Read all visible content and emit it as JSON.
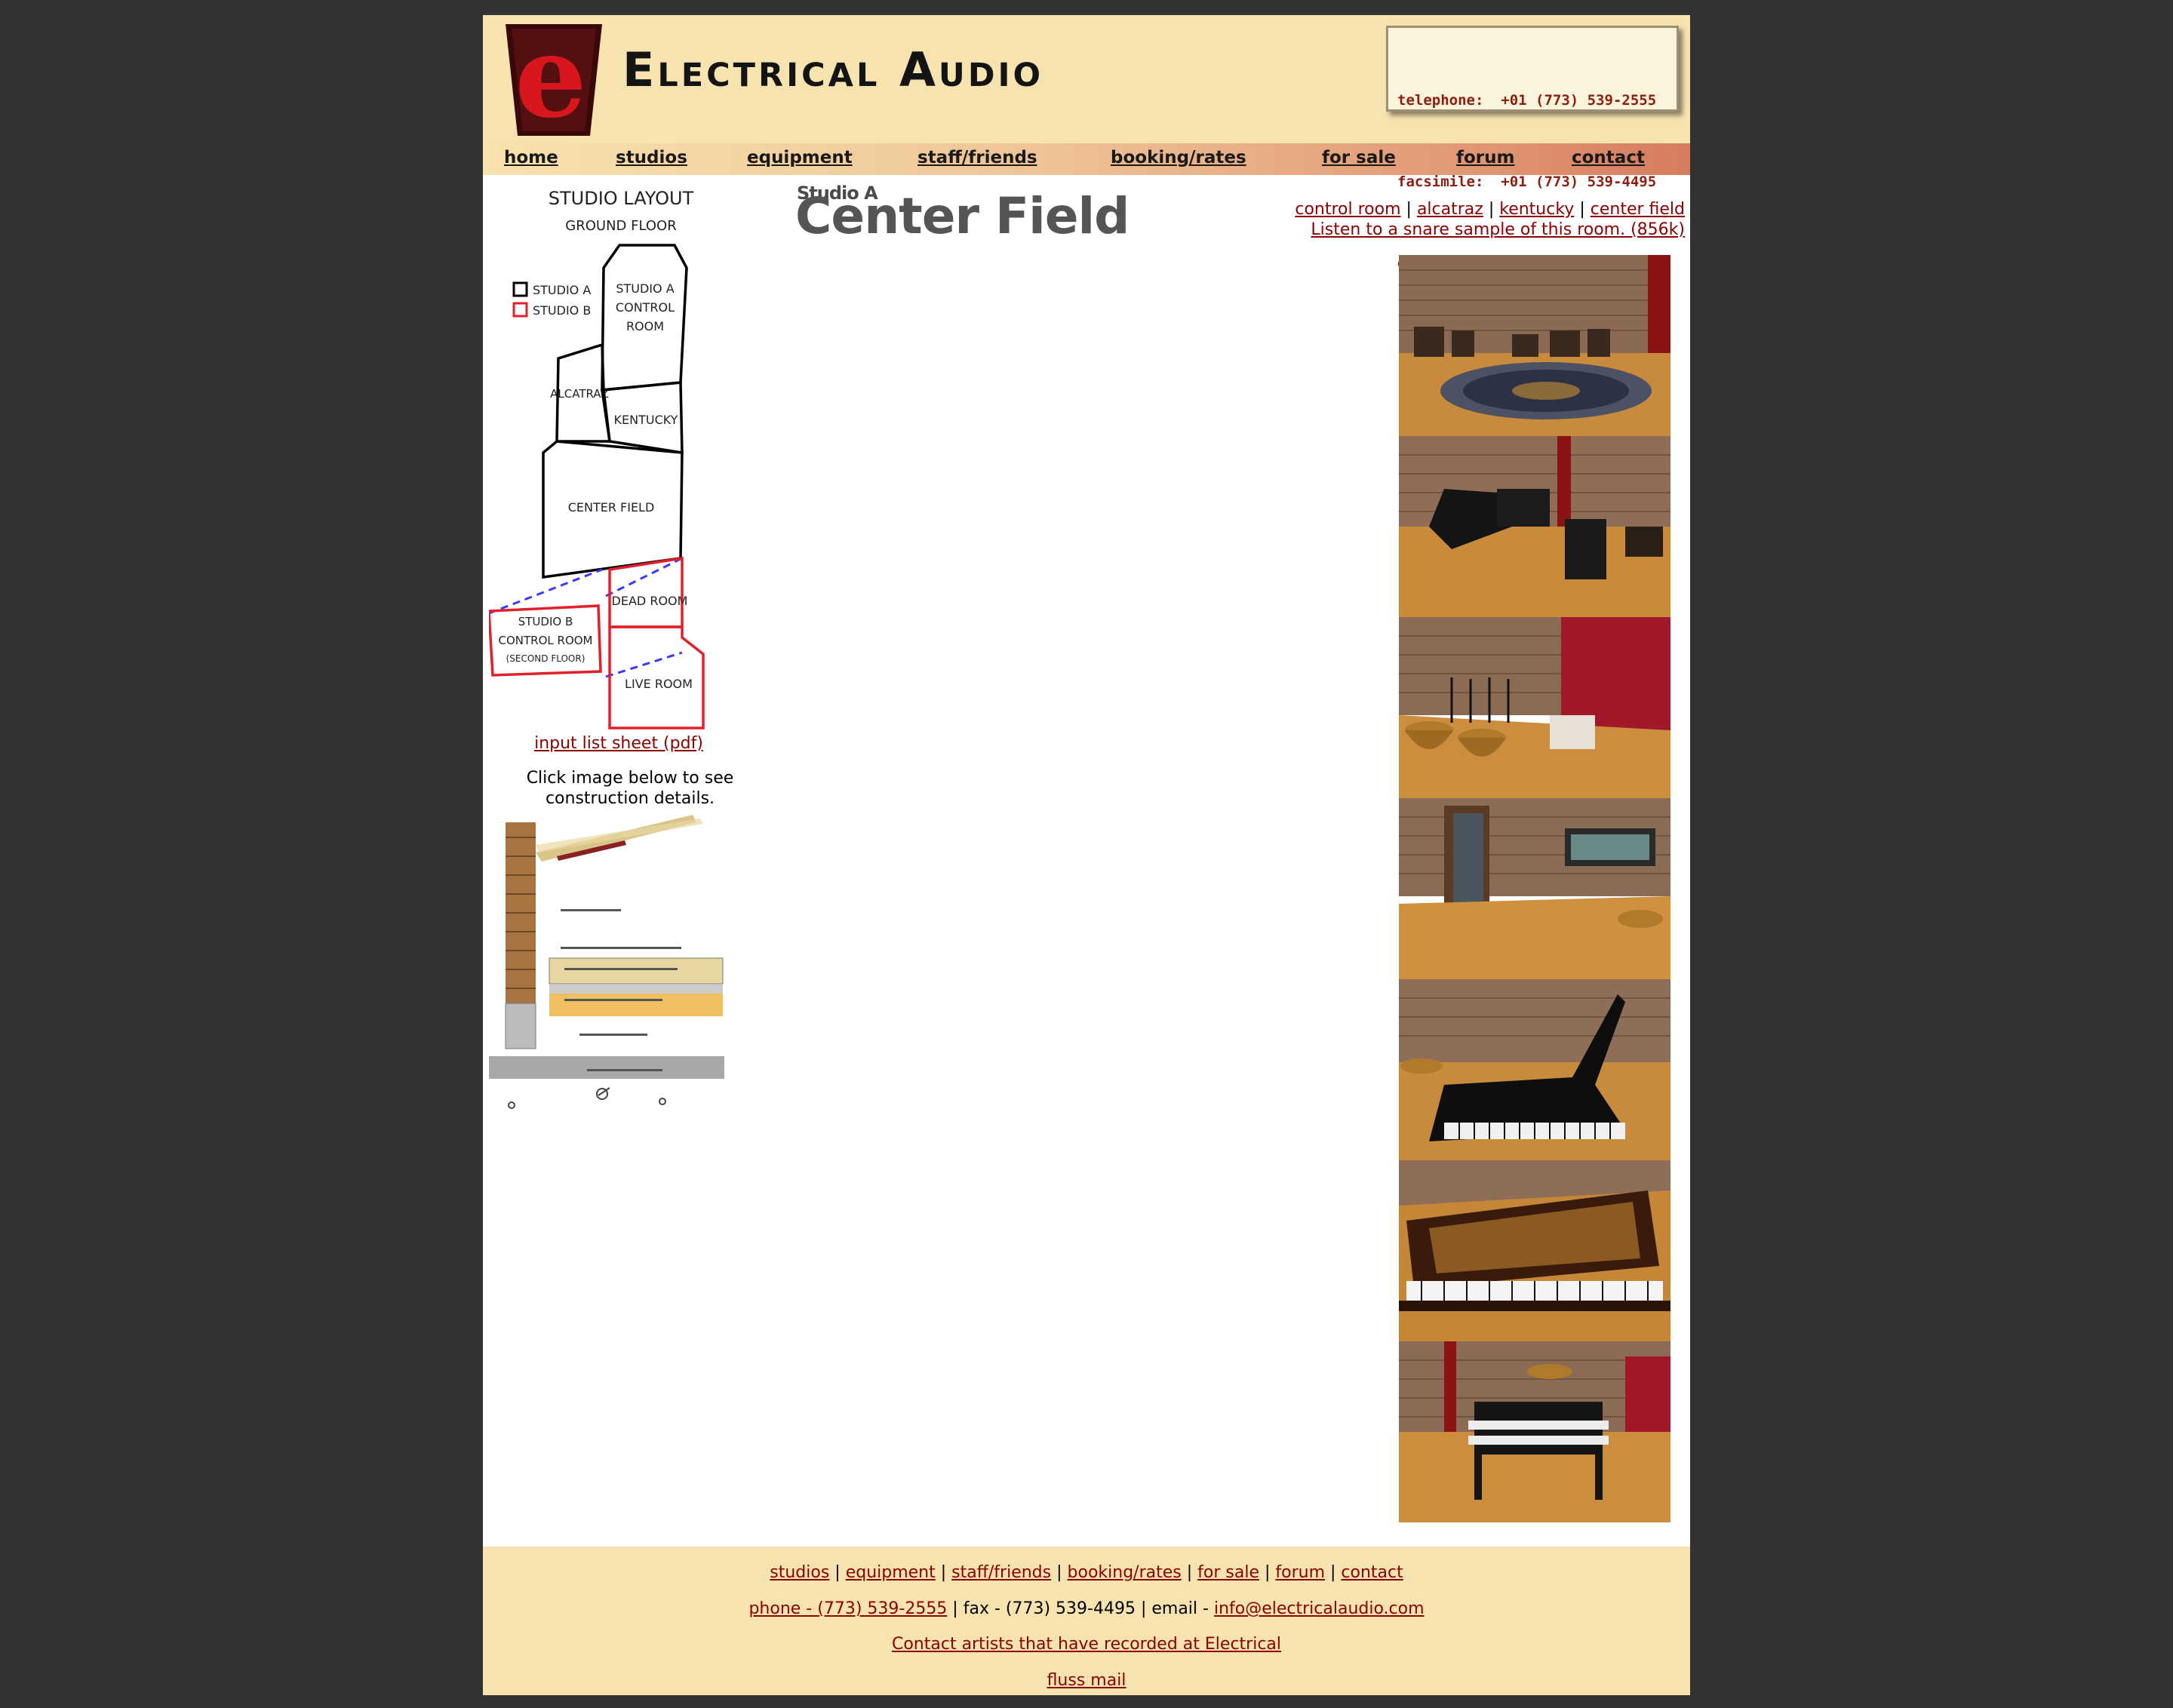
{
  "header": {
    "site_name": "Electrical Audio",
    "contact": {
      "telephone": "telephone:  +01 (773) 539-2555",
      "facsimile": "facsimile:  +01 (773) 539-4495",
      "email": "email:info@electricalaudio.com"
    }
  },
  "nav": [
    {
      "label": "home"
    },
    {
      "label": "studios"
    },
    {
      "label": "equipment"
    },
    {
      "label": "staff/friends"
    },
    {
      "label": "booking/rates"
    },
    {
      "label": "for sale"
    },
    {
      "label": "forum"
    },
    {
      "label": "contact"
    }
  ],
  "floorplan": {
    "title": "STUDIO LAYOUT",
    "subtitle": "GROUND FLOOR",
    "legend_a": "STUDIO A",
    "legend_b": "STUDIO B",
    "rooms": {
      "control_a_1": "STUDIO A",
      "control_a_2": "CONTROL",
      "control_a_3": "ROOM",
      "alcatraz": "ALCATRAZ",
      "kentucky": "KENTUCKY",
      "center_field": "CENTER FIELD",
      "dead_room": "DEAD ROOM",
      "control_b_1": "STUDIO B",
      "control_b_2": "CONTROL ROOM",
      "control_b_3": "(SECOND FLOOR)",
      "live_room": "LIVE ROOM"
    },
    "colors": {
      "studio_a": "#000000",
      "studio_b": "#e0202a",
      "link_line": "#3a3aff"
    }
  },
  "input_list_link": "input list sheet (pdf)",
  "construction_note": "Click image below to see construction details.",
  "title": {
    "small": "Studio A",
    "big": "Center Field"
  },
  "room_links": {
    "control_room": "control room",
    "alcatraz": "alcatraz",
    "kentucky": "kentucky",
    "center_field": "center field",
    "separator": "|",
    "snare_sample": "Listen to a snare sample of this room. (856k)"
  },
  "photos_count": 7,
  "footer": {
    "links": [
      "studios",
      "equipment",
      "staff/friends",
      "booking/rates",
      "for sale",
      "forum",
      "contact"
    ],
    "phone_link": "phone - (773) 539-2555",
    "fax_text": " | fax - (773) 539-4495 | email - ",
    "email_link": "info@electricalaudio.com",
    "artists_link": "Contact artists that have recorded at Electrical",
    "fluss_link": "fluss mail"
  },
  "colors": {
    "background": "#333333",
    "header_bg": "#f7e3b0",
    "link": "#8b0000",
    "contact_text": "#8e1f10"
  }
}
